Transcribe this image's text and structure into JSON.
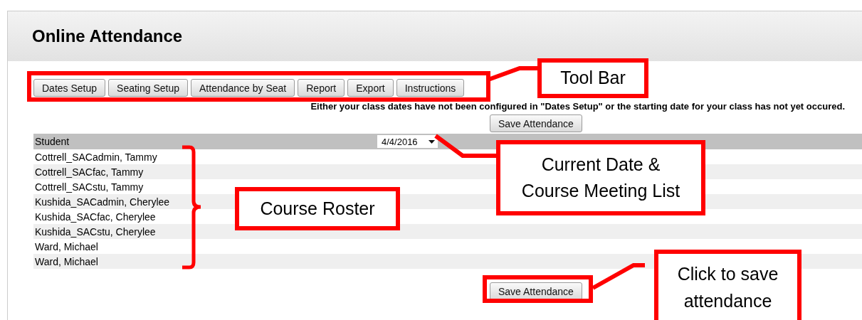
{
  "window": {
    "title": "Online Attendance"
  },
  "toolbar": [
    {
      "label": "Dates Setup"
    },
    {
      "label": "Seating Setup"
    },
    {
      "label": "Attendance by Seat"
    },
    {
      "label": "Report"
    },
    {
      "label": "Export"
    },
    {
      "label": "Instructions"
    }
  ],
  "message": "Either your class dates have not been configured in \"Dates Setup\" or the starting date for your class has not yet occured.",
  "save_button_top": "Save Attendance",
  "table": {
    "column": "Student",
    "date_select": {
      "value": "4/4/2016"
    },
    "rows": [
      {
        "name": "Cottrell_SACadmin, Tammy"
      },
      {
        "name": "Cottrell_SACfac, Tammy"
      },
      {
        "name": "Cottrell_SACstu, Tammy"
      },
      {
        "name": "Kushida_SACadmin, Cherylee"
      },
      {
        "name": "Kushida_SACfac, Cherylee"
      },
      {
        "name": "Kushida_SACstu, Cherylee"
      },
      {
        "name": "Ward, Michael"
      },
      {
        "name": "Ward, Michael"
      }
    ]
  },
  "save_button_bottom": "Save Attendance",
  "callouts": [
    {
      "text": "Tool Bar"
    },
    {
      "text": "Course Roster"
    },
    {
      "text": "Current Date & Course Meeting List"
    },
    {
      "text": "Click to save attendance"
    }
  ]
}
